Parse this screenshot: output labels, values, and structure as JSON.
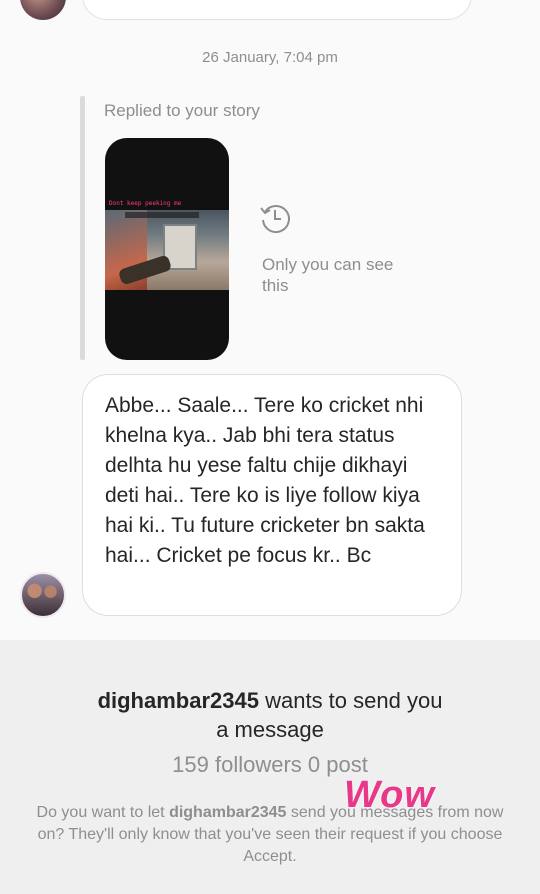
{
  "thread": {
    "timestamp": "26 January, 7:04 pm",
    "reply_label": "Replied to your story",
    "story_overlay_text": "Dont keep peeking me",
    "story_visibility": "Only you can see this",
    "message": "Abbe... Saale... Tere ko cricket nhi khelna kya.. Jab bhi tera status delhta hu yese faltu chije dikhayi deti hai.. Tere ko is liye follow kiya hai ki.. Tu future cricketer bn sakta hai... Cricket pe focus kr.. Bc"
  },
  "request": {
    "username": "dighambar2345",
    "title_suffix": "wants to send you",
    "title_line2": "a message",
    "stats": "159 followers 0 post",
    "body_prefix": "Do you want to let",
    "body_suffix": "send you messages from now on? They'll only know that you've seen their request if you choose Accept."
  },
  "sticker": {
    "text": "Wow",
    "color": "#e8388a"
  },
  "icons": {
    "history": "history-clock-icon"
  }
}
